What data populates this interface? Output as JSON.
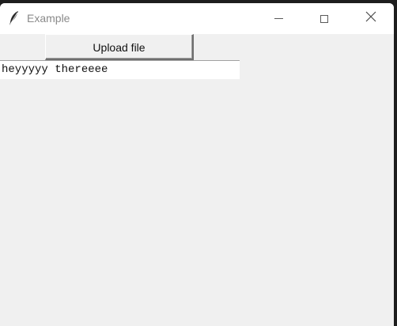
{
  "window": {
    "title": "Example"
  },
  "toolbar": {
    "upload_label": "Upload file"
  },
  "entry": {
    "value": "heyyyyy thereeee"
  },
  "icons": {
    "app": "feather-icon",
    "minimize": "minimize-icon",
    "maximize": "maximize-icon",
    "close": "close-icon"
  }
}
